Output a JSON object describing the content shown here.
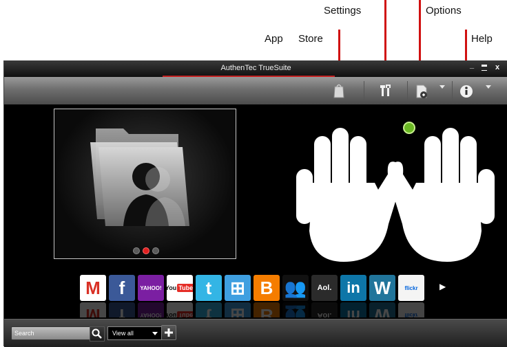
{
  "callouts": {
    "settings": "Settings",
    "options": "Options",
    "app": "App",
    "store": "Store",
    "help": "Help"
  },
  "window": {
    "title": "AuthenTec TrueSuite",
    "minimize": "_",
    "maximize": "▀",
    "close": "x"
  },
  "toolbar": {
    "icons": [
      "app-store-icon",
      "settings-icon",
      "options-icon",
      "help-icon"
    ]
  },
  "carousel": {
    "pages": 3,
    "active_page": 2
  },
  "dock": {
    "apps": [
      {
        "name": "Gmail",
        "label": "M",
        "color": "#ffffff",
        "fg": "#d93025"
      },
      {
        "name": "Facebook",
        "label": "f",
        "color": "#3b5998",
        "fg": "#ffffff"
      },
      {
        "name": "Yahoo",
        "label": "YAHOO!",
        "color": "#7b1fa2",
        "fg": "#ffffff"
      },
      {
        "name": "YouTube",
        "label": "You",
        "label2": "Tube",
        "color": "#ffffff",
        "fg": "#111111"
      },
      {
        "name": "Twitter",
        "label": "t",
        "color": "#33b5e5",
        "fg": "#ffffff"
      },
      {
        "name": "Windows",
        "label": "⊞",
        "color": "#3f9fe0",
        "fg": "#ffffff"
      },
      {
        "name": "Blogger",
        "label": "B",
        "color": "#f57d00",
        "fg": "#ffffff"
      },
      {
        "name": "MySpace",
        "label": "👥",
        "color": "#111111",
        "fg": "#ffffff"
      },
      {
        "name": "AOL",
        "label": "Aol.",
        "color": "#2b2b2b",
        "fg": "#ffffff"
      },
      {
        "name": "LinkedIn",
        "label": "in",
        "color": "#0e76a8",
        "fg": "#ffffff"
      },
      {
        "name": "WordPress",
        "label": "W",
        "color": "#21759b",
        "fg": "#ffffff"
      },
      {
        "name": "Flickr",
        "label": "flickr",
        "color": "#f4f4f4",
        "fg": "#0063dc"
      }
    ],
    "next_arrow": "▶"
  },
  "statusbar": {
    "search_placeholder": "Search",
    "view_option": "View all"
  }
}
